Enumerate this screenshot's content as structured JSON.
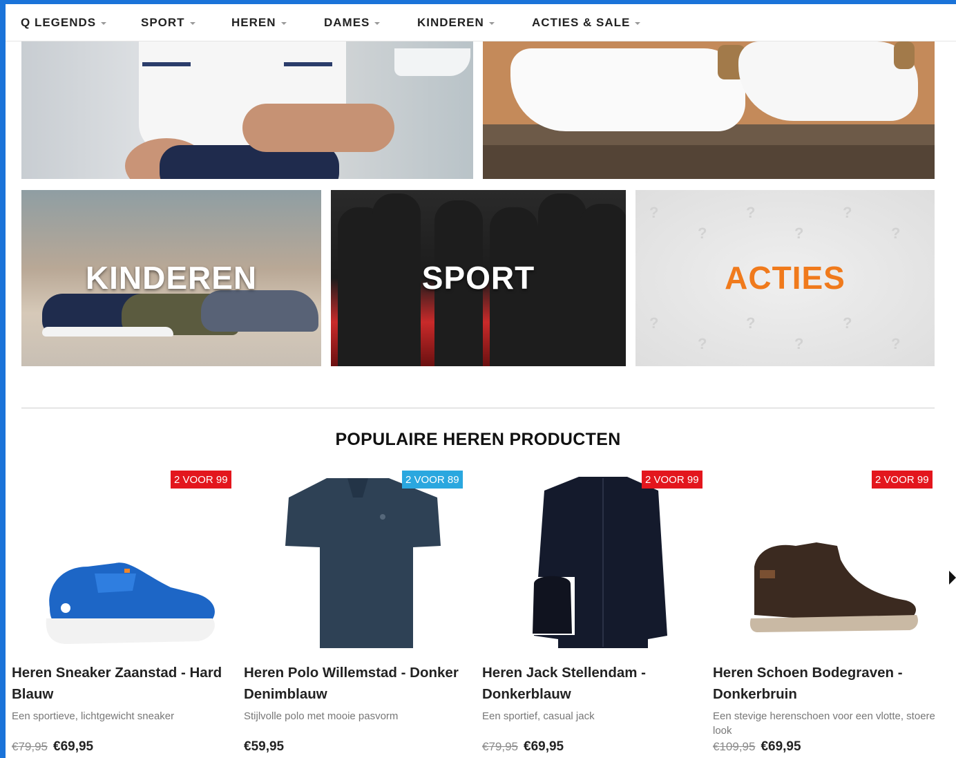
{
  "nav": {
    "items": [
      {
        "label": "Q LEGENDS"
      },
      {
        "label": "SPORT"
      },
      {
        "label": "HEREN"
      },
      {
        "label": "DAMES"
      },
      {
        "label": "KINDEREN"
      },
      {
        "label": "ACTIES & SALE"
      }
    ]
  },
  "banners": {
    "kinderen": "KINDEREN",
    "sport": "SPORT",
    "acties": "ACTIES"
  },
  "section_title": "POPULAIRE HEREN PRODUCTEN",
  "products": [
    {
      "badge": "2 VOOR 99",
      "badge_color": "#e3161d",
      "name": "Heren Sneaker Zaanstad - Hard Blauw",
      "desc": "Een sportieve, lichtgewicht sneaker",
      "old_price": "€79,95",
      "price": "€69,95"
    },
    {
      "badge": "2 VOOR 89",
      "badge_color": "#2aa7df",
      "name": "Heren Polo Willemstad - Donker Denimblauw",
      "desc": "Stijlvolle polo met mooie pasvorm",
      "old_price": "",
      "price": "€59,95"
    },
    {
      "badge": "2 VOOR 99",
      "badge_color": "#e3161d",
      "name": "Heren Jack Stellendam - Donkerblauw",
      "desc": "Een sportief, casual jack",
      "old_price": "€79,95",
      "price": "€69,95"
    },
    {
      "badge": "2 VOOR 99",
      "badge_color": "#e3161d",
      "name": "Heren Schoen Bodegraven - Donkerbruin",
      "desc": "Een stevige herenschoen voor een vlotte, stoere look",
      "old_price": "€109,95",
      "price": "€69,95"
    }
  ],
  "colors": {
    "frame": "#1a73d9",
    "accent_orange": "#f07a1c",
    "badge_red": "#e3161d",
    "badge_blue": "#2aa7df"
  }
}
